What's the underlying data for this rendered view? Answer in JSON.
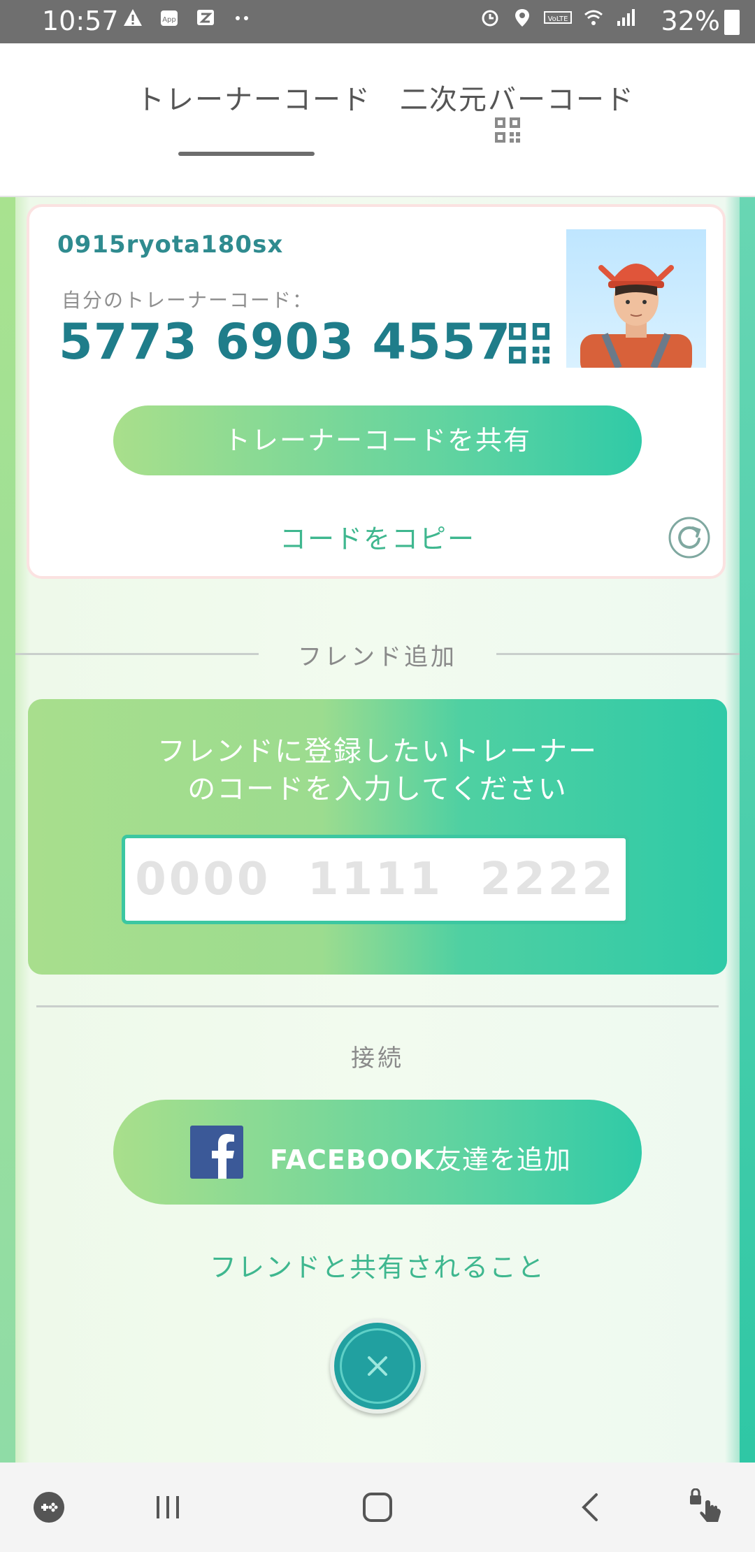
{
  "status_bar": {
    "time": "10:57",
    "battery": "32%",
    "left_icons": [
      "warning-icon",
      "app-icon",
      "zedge-icon",
      "more-dots-icon"
    ],
    "right_icons": [
      "alarm-icon",
      "location-icon",
      "volte-icon",
      "wifi-icon",
      "signal-icon",
      "battery-icon"
    ]
  },
  "tabs": [
    {
      "label": "トレーナーコード",
      "active": true
    },
    {
      "label": "二次元バーコード",
      "active": false,
      "icon": "qr-icon"
    }
  ],
  "profile": {
    "username": "0915ryota180sx",
    "code_label": "自分のトレーナーコード：",
    "code": "5773 6903 4557"
  },
  "actions": {
    "share_code": "トレーナーコードを共有",
    "copy_code": "コードをコピー"
  },
  "add_friend": {
    "section_label": "フレンド追加",
    "instruction_line1": "フレンドに登録したいトレーナー",
    "instruction_line2": "のコードを入力してください",
    "input_placeholder": "0000  1111  2222",
    "input_value": ""
  },
  "connect": {
    "section_label": "接続",
    "facebook_bold": "FACEBOOK",
    "facebook_rest": "友達を追加",
    "shared_info_link": "フレンドと共有されること"
  },
  "colors": {
    "accent_teal": "#1f7d8a",
    "link_green": "#3fb78f",
    "button_gradient_start": "#a9df8b",
    "button_gradient_end": "#2fcaa7",
    "facebook_blue": "#3b5998"
  },
  "nav_bar": {
    "items": [
      "game-launcher-icon",
      "recent-apps-icon",
      "home-icon",
      "back-icon",
      "touch-lock-icon"
    ]
  }
}
